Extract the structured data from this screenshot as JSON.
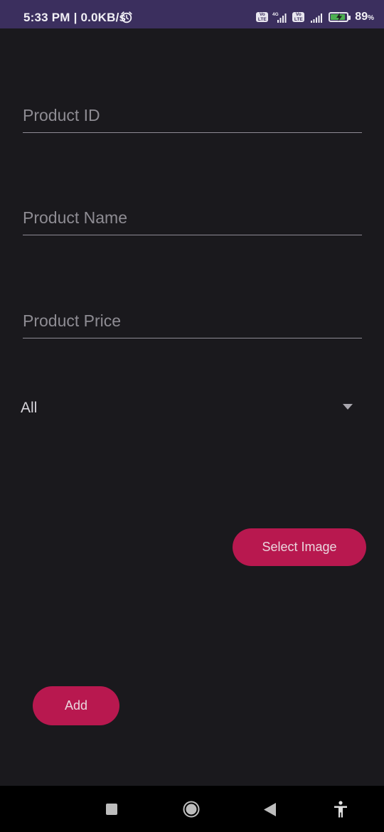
{
  "status_bar": {
    "time_speed": "5:33 PM | 0.0KB/s",
    "alarm_icon": "alarm-clock-icon",
    "volte_1": "Vo LTE",
    "network_type": "4G",
    "volte_2": "Vo LTE",
    "battery_level": "89",
    "battery_unit": "%",
    "battery_fraction": 0.89,
    "battery_color": "#4caf50"
  },
  "form": {
    "product_id": {
      "placeholder": "Product ID",
      "value": ""
    },
    "product_name": {
      "placeholder": "Product Name",
      "value": ""
    },
    "product_price": {
      "placeholder": "Product Price",
      "value": ""
    },
    "category_spinner": {
      "selected": "All"
    }
  },
  "buttons": {
    "select_image": "Select Image",
    "add": "Add",
    "accent_color": "#b8184f"
  },
  "nav_bar": {
    "recents_icon": "square-recents-icon",
    "home_icon": "circle-home-icon",
    "back_icon": "triangle-back-icon",
    "accessibility_icon": "accessibility-person-icon"
  }
}
